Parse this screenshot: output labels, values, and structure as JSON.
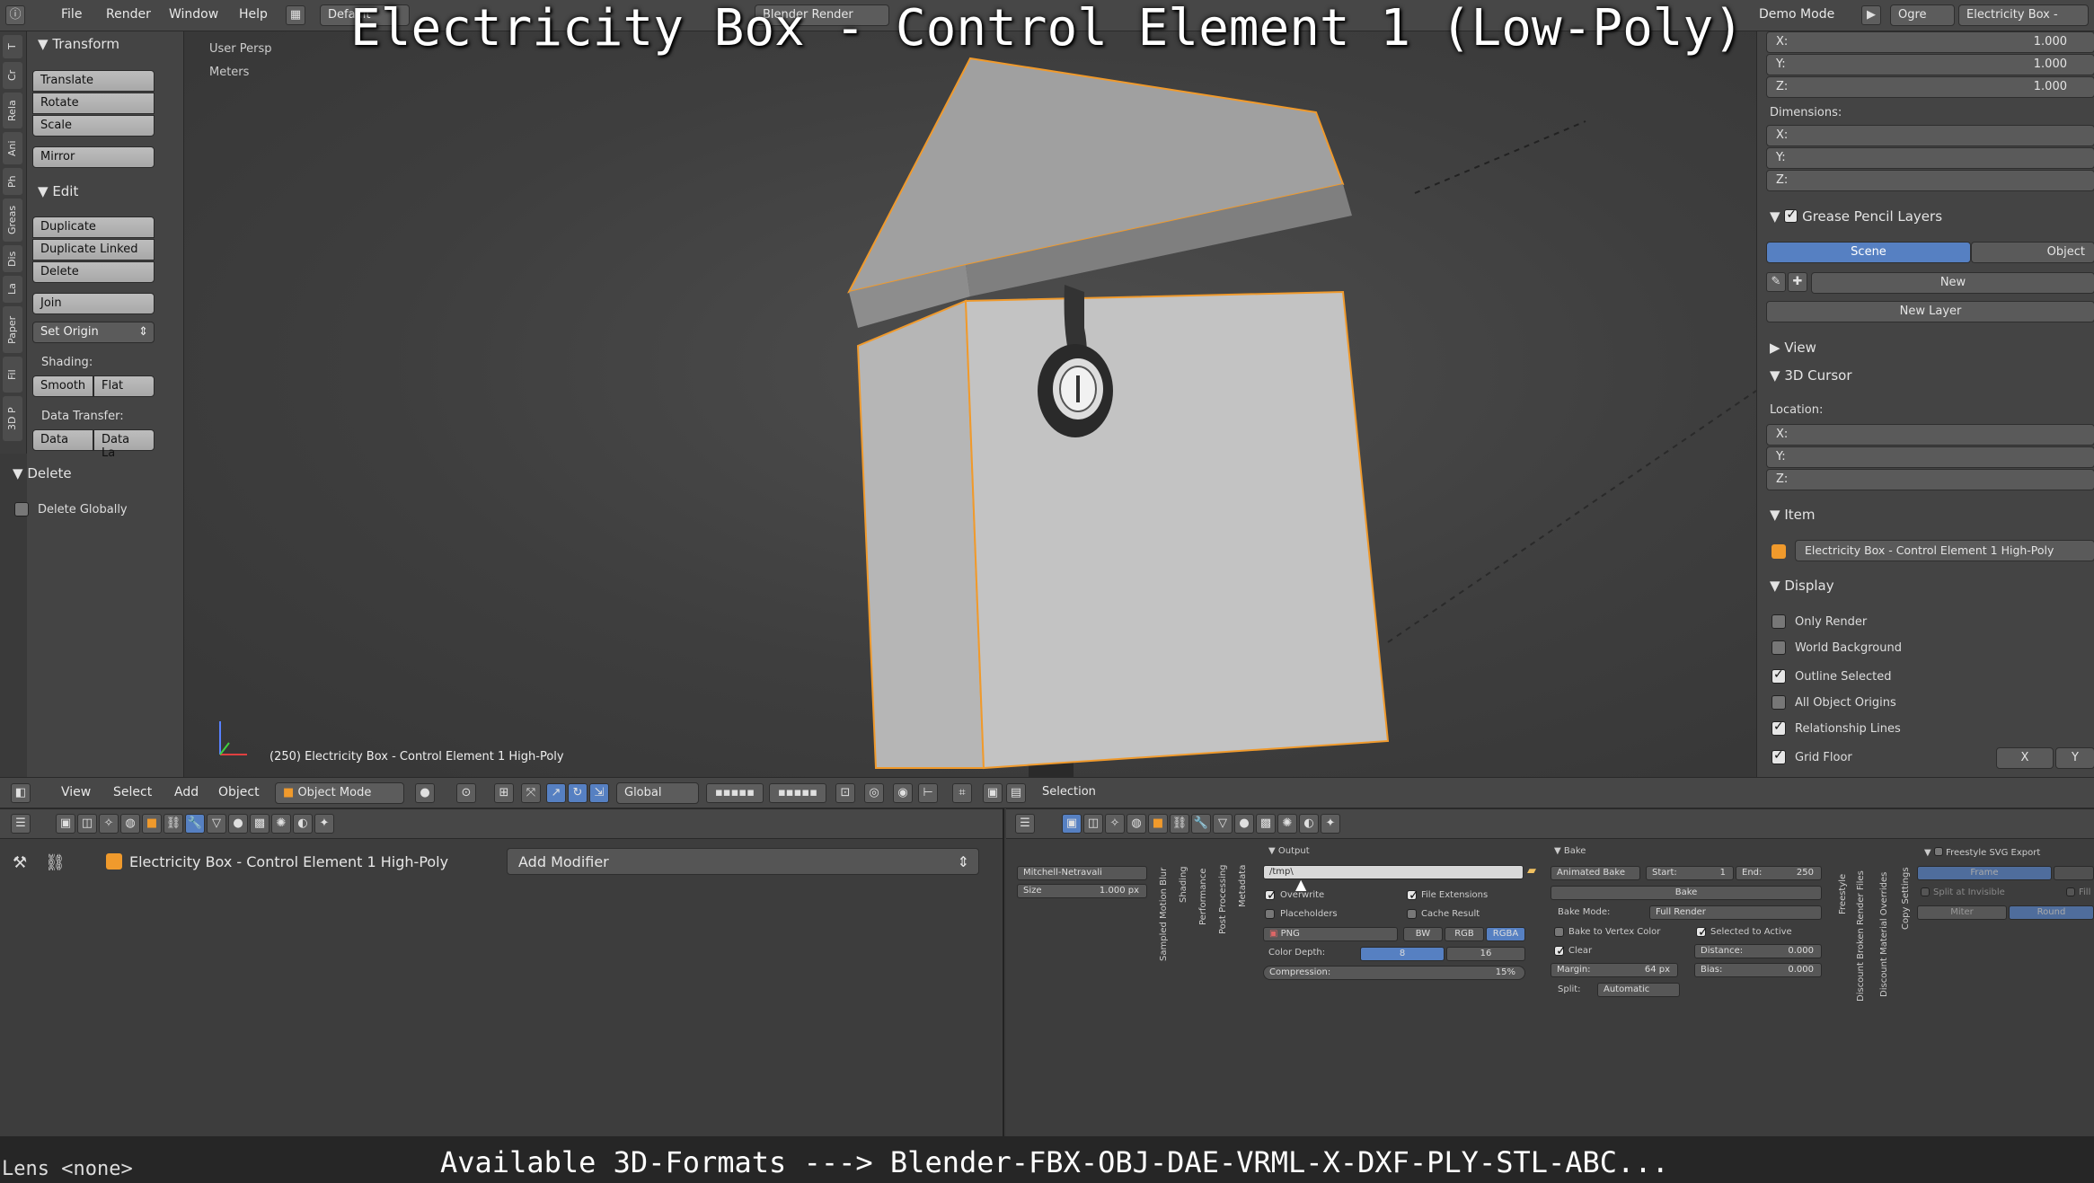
{
  "overlay": {
    "title": "Electricity Box - Control Element 1 (Low-Poly)",
    "bottom_text": "Available 3D-Formats ---> Blender-FBX-OBJ-DAE-VRML-X-DXF-PLY-STL-ABC...",
    "lens": "Lens <none>"
  },
  "topbar": {
    "menus": [
      "File",
      "Render",
      "Window",
      "Help"
    ],
    "layout": "Default",
    "engine": "Blender Render",
    "demo_mode": "Demo Mode",
    "ogre": "Ogre",
    "scene_name": "Electricity Box -"
  },
  "vertical_tabs": [
    "T",
    "Cr",
    "Rela",
    "Ani",
    "Ph",
    "Greas",
    "Dis",
    "La",
    "Paper",
    "Fil",
    "3D P"
  ],
  "toolshelf": {
    "transform_header": "Transform",
    "transform_buttons": [
      "Translate",
      "Rotate",
      "Scale"
    ],
    "mirror": "Mirror",
    "edit_header": "Edit",
    "edit_buttons": [
      "Duplicate",
      "Duplicate Linked",
      "Delete"
    ],
    "join": "Join",
    "set_origin": "Set Origin",
    "shading_label": "Shading:",
    "smooth": "Smooth",
    "flat": "Flat",
    "data_transfer_label": "Data Transfer:",
    "data": "Data",
    "data_la": "Data La",
    "delete_header": "Delete",
    "delete_globally": "Delete Globally"
  },
  "viewport": {
    "view_name": "User Persp",
    "units": "Meters",
    "object_info": "(250) Electricity Box - Control Element 1 High-Poly"
  },
  "properties": {
    "scale_x": "X:",
    "scale_x_val": "1.000",
    "scale_y": "Y:",
    "scale_y_val": "1.000",
    "scale_z": "Z:",
    "scale_z_val": "1.000",
    "dimensions_label": "Dimensions:",
    "dim_x": "X:",
    "dim_y": "Y:",
    "dim_z": "Z:",
    "grease_pencil_header": "Grease Pencil Layers",
    "scene_tab": "Scene",
    "object_tab": "Object",
    "new_btn": "New",
    "new_layer_btn": "New Layer",
    "view_header": "View",
    "cursor_header": "3D Cursor",
    "location_label": "Location:",
    "loc_x": "X:",
    "loc_y": "Y:",
    "loc_z": "Z:",
    "item_header": "Item",
    "item_name": "Electricity Box - Control Element 1 High-Poly",
    "display_header": "Display",
    "only_render": "Only Render",
    "world_background": "World Background",
    "outline_selected": "Outline Selected",
    "all_object_origins": "All Object Origins",
    "relationship_lines": "Relationship Lines",
    "grid_floor": "Grid Floor",
    "grid_x": "X",
    "grid_y": "Y"
  },
  "view3d_header": {
    "menus": [
      "View",
      "Select",
      "Add",
      "Object"
    ],
    "mode": "Object Mode",
    "orientation": "Global",
    "selection_label": "Selection"
  },
  "modifier_panel": {
    "object_name": "Electricity Box - Control Element 1 High-Poly",
    "add_modifier": "Add Modifier"
  },
  "render_panel": {
    "filter": "Mitchell-Netravali",
    "size": "Size",
    "size_val": "1.000 px",
    "vertical_tabs_a": [
      "Sampled Motion Blur",
      "Shading",
      "Performance",
      "Post Processing",
      "Metadata"
    ],
    "output_header": "Output",
    "output_path": "/tmp\\",
    "overwrite": "Overwrite",
    "file_extensions": "File Extensions",
    "placeholders": "Placeholders",
    "cache_result": "Cache Result",
    "format": "PNG",
    "bw": "BW",
    "rgb": "RGB",
    "rgba": "RGBA",
    "color_depth_label": "Color Depth:",
    "depth_8": "8",
    "depth_16": "16",
    "compression_label": "Compression:",
    "compression_val": "15%",
    "bake_header": "Bake",
    "animated_bake": "Animated Bake",
    "start_label": "Start:",
    "start_val": "1",
    "end_label": "End:",
    "end_val": "250",
    "bake_btn": "Bake",
    "bake_mode_label": "Bake Mode:",
    "bake_mode": "Full Render",
    "bake_to_vertex": "Bake to Vertex Color",
    "selected_to_active": "Selected to Active",
    "clear": "Clear",
    "distance_label": "Distance:",
    "distance_val": "0.000",
    "margin_label": "Margin:",
    "margin_val": "64 px",
    "bias_label": "Bias:",
    "bias_val": "0.000",
    "split_label": "Split:",
    "split_val": "Automatic",
    "vertical_tabs_b": [
      "Freestyle",
      "Discount Broken Render Files",
      "Discount Material Overrides",
      "Copy Settings"
    ],
    "freestyle_header": "Freestyle SVG Export",
    "frame": "Frame",
    "split_invisible": "Split at Invisible",
    "fill": "Fill",
    "miter": "Miter",
    "round": "Round"
  },
  "colors": {
    "accent": "#5680c2",
    "panel": "#444444",
    "viewport_bg": "#3e3e3e",
    "object_outline": "#f09a2c"
  }
}
